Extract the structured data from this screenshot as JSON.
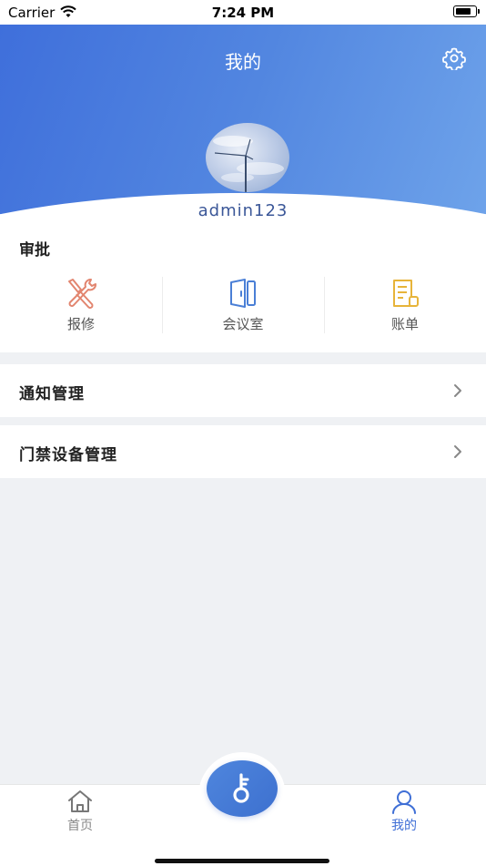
{
  "status_bar": {
    "carrier": "Carrier",
    "time": "7:24 PM"
  },
  "header": {
    "title": "我的",
    "username": "admin123"
  },
  "approval": {
    "title": "审批",
    "items": [
      {
        "label": "报修",
        "icon": "wrench-screwdriver-icon",
        "color": "#e2856f"
      },
      {
        "label": "会议室",
        "icon": "door-icon",
        "color": "#4a7fd6"
      },
      {
        "label": "账单",
        "icon": "bill-icon",
        "color": "#e7b43a"
      }
    ]
  },
  "menu": [
    {
      "label": "通知管理"
    },
    {
      "label": "门禁设备管理"
    }
  ],
  "tabbar": {
    "home_label": "首页",
    "mine_label": "我的",
    "active_color": "#3f6fd6",
    "inactive_color": "#888888"
  }
}
